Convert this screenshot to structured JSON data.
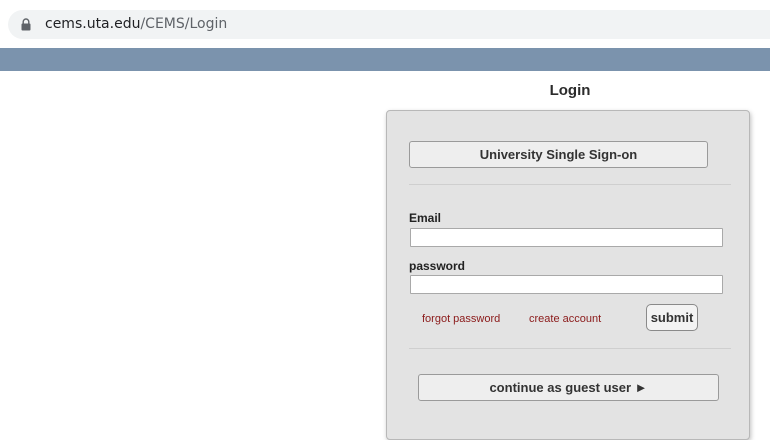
{
  "browser": {
    "url_domain": "cems.uta.edu",
    "url_path": "/CEMS/Login"
  },
  "page": {
    "title": "Login"
  },
  "login": {
    "sso_button": "University Single Sign-on",
    "email_label": "Email",
    "email_value": "",
    "password_label": "password",
    "password_value": "",
    "forgot_link": "forgot password",
    "create_link": "create account",
    "submit_button": "submit",
    "guest_button": "continue as guest user ►"
  },
  "colors": {
    "header_band": "#7b93ad",
    "panel_bg": "#e3e3e3",
    "link": "#8b1a1a"
  },
  "icons": {
    "lock": "lock-icon"
  }
}
